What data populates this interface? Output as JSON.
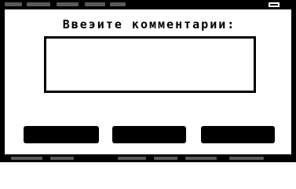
{
  "dialog": {
    "prompt": "Ввеэите комментарии:",
    "comment_value": ""
  },
  "buttons": [
    {
      "label": ""
    },
    {
      "label": ""
    },
    {
      "label": ""
    }
  ],
  "colors": {
    "background": "#ffffff",
    "chrome": "#000000",
    "muted": "#5a5a5a"
  },
  "icons": {
    "titlebar": "window-control-icon"
  }
}
